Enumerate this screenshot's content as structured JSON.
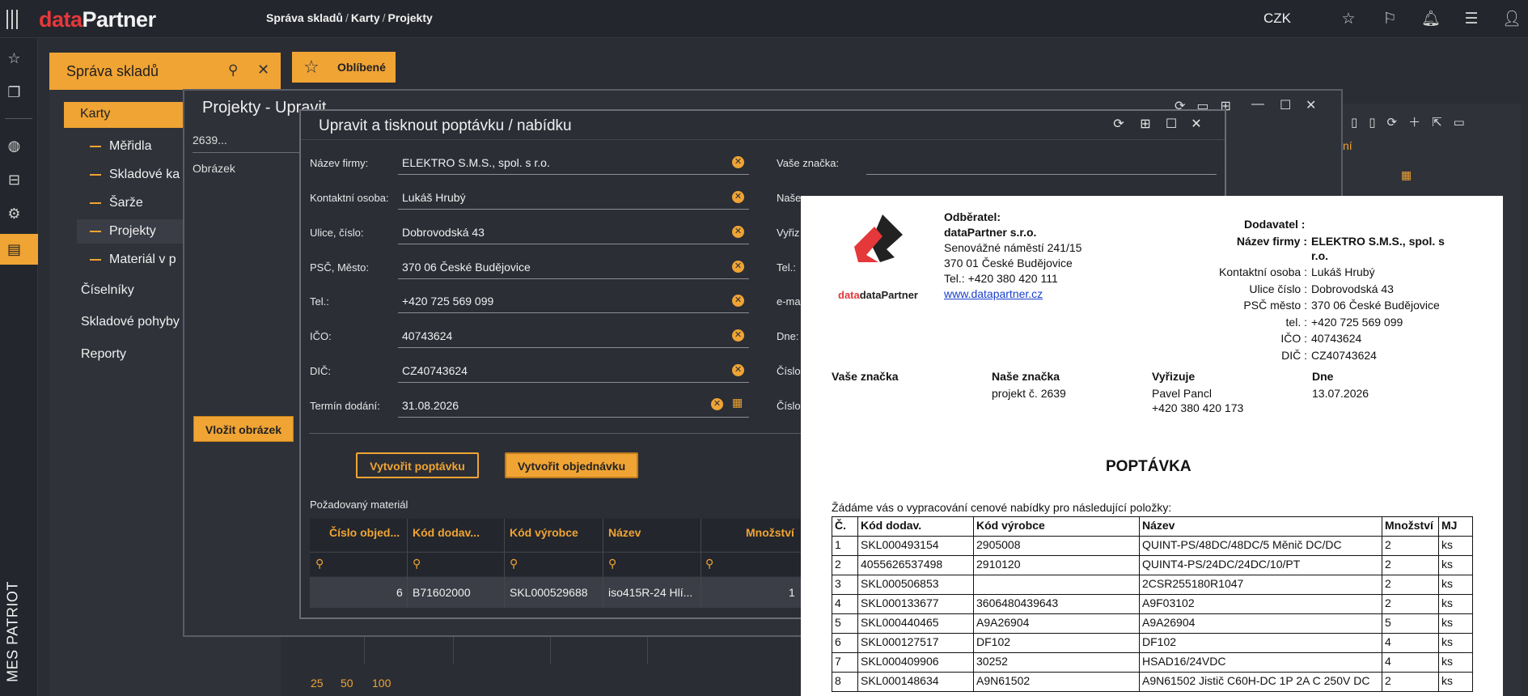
{
  "app": {
    "logo_data": "data",
    "logo_partner": "Partner",
    "brand_color": "#e5383b",
    "accent": "#f0a434"
  },
  "breadcrumb": {
    "a": "Správa skladů",
    "b": "Karty",
    "c": "Projekty",
    "sep": "/"
  },
  "top": {
    "currency": "CZK"
  },
  "rail": {
    "mes": "MES PATRIOT"
  },
  "panel": {
    "title": "Správa skladů",
    "fav": "Oblíbené"
  },
  "nav": {
    "karty": "Karty",
    "meridla": "Měřidla",
    "skladove_karty": "Skladové ka",
    "sarze": "Šarže",
    "projekty": "Projekty",
    "material": "Materiál v p",
    "ciselniky": "Číselníky",
    "pohyby": "Skladové pohyby",
    "reporty": "Reporty"
  },
  "proj": {
    "title": "Projekty - Upravit",
    "value": "2639...",
    "obrazek": "Obrázek",
    "vlozit": "Vložit obrázek"
  },
  "dialog": {
    "title": "Upravit a tisknout poptávku / nabídku",
    "fields": {
      "firma_l": "Název firmy:",
      "firma_v": "ELEKTRO S.M.S., spol. s r.o.",
      "kontakt_l": "Kontaktní osoba:",
      "kontakt_v": "Lukáš Hrubý",
      "ulice_l": "Ulice, číslo:",
      "ulice_v": "Dobrovodská 43",
      "psc_l": "PSČ, Město:",
      "psc_v": "370 06 České Budějovice",
      "tel_l": "Tel.:",
      "tel_v": "+420 725 569 099",
      "ico_l": "IČO:",
      "ico_v": "40743624",
      "dic_l": "DIČ:",
      "dic_v": "CZ40743624",
      "termin_l": "Termín dodání:",
      "termin_v": "31.08.2026"
    },
    "right": {
      "vase": "Vaše značka:",
      "nase": "Naše zn",
      "vyriz": "Vyřiz",
      "tel": "Tel.:",
      "email": "e-ma",
      "dne": "Dne:",
      "cislo1": "Číslo",
      "cislo2": "Číslo"
    },
    "btn_poptavka": "Vytvořit poptávku",
    "btn_objednavka": "Vytvořit objednávku",
    "req_label": "Požadovaný materiál",
    "grid_headers": [
      "Číslo objed...",
      "Kód dodav...",
      "Kód výrobce",
      "Název",
      "Množství"
    ],
    "grid_row": [
      "6",
      "B71602000",
      "SKL000529688",
      "iso415R-24 Hlí...",
      "1"
    ]
  },
  "pager": [
    "25",
    "50",
    "100"
  ],
  "paper": {
    "odb_label": "Odběratel:",
    "odb_name": "dataPartner s.r.o.",
    "odb_addr1": "Senovážné náměstí 241/15",
    "odb_addr2": "370 01 České Budějovice",
    "odb_tel": "Tel.: +420 380 420 111",
    "odb_www": "www.datapartner.cz",
    "logo_text": "dataPartner",
    "dod_label": "Dodavatel :",
    "dod_rows": [
      {
        "k": "Název firmy :",
        "v": "ELEKTRO S.M.S., spol. s"
      },
      {
        "k": "",
        "v": "r.o."
      },
      {
        "k": "Kontaktní osoba :",
        "v": "Lukáš Hrubý"
      },
      {
        "k": "Ulice číslo :",
        "v": "Dobrovodská 43"
      },
      {
        "k": "PSČ město :",
        "v": "370 06 České Budějovice"
      },
      {
        "k": "tel. :",
        "v": "+420 725 569 099"
      },
      {
        "k": "IČO :",
        "v": "40743624"
      },
      {
        "k": "DIČ :",
        "v": "CZ40743624"
      }
    ],
    "vase_l": "Vaše značka",
    "nase_l": "Naše značka",
    "nase_v": "projekt č. 2639",
    "vyriz_l": "Vyřizuje",
    "vyriz_v1": "Pavel Pancl",
    "vyriz_v2": "+420 380 420 173",
    "dne_l": "Dne",
    "dne_v": "13.07.2026",
    "title": "POPTÁVKA",
    "intro": "Žádáme vás o vypracování cenové nabídky pro následující položky:",
    "headers": [
      "Č.",
      "Kód dodav.",
      "Kód výrobce",
      "Název",
      "Množství",
      "MJ"
    ],
    "rows": [
      [
        "1",
        "SKL000493154",
        "2905008",
        "QUINT-PS/48DC/48DC/5 Měnič DC/DC",
        "2",
        "ks"
      ],
      [
        "2",
        "4055626537498",
        "2910120",
        "QUINT4-PS/24DC/24DC/10/PT",
        "2",
        "ks"
      ],
      [
        "3",
        "SKL000506853",
        "",
        "2CSR255180R1047",
        "2",
        "ks"
      ],
      [
        "4",
        "SKL000133677",
        "3606480439643",
        "A9F03102",
        "2",
        "ks"
      ],
      [
        "5",
        "SKL000440465",
        "A9A26904",
        "A9A26904",
        "5",
        "ks"
      ],
      [
        "6",
        "SKL000127517",
        "DF102",
        "DF102",
        "4",
        "ks"
      ],
      [
        "7",
        "SKL000409906",
        "30252",
        "HSAD16/24VDC",
        "4",
        "ks"
      ],
      [
        "8",
        "SKL000148634",
        "A9N61502",
        "A9N61502 Jistič C60H-DC 1P 2A C 250V DC",
        "2",
        "ks"
      ]
    ]
  }
}
